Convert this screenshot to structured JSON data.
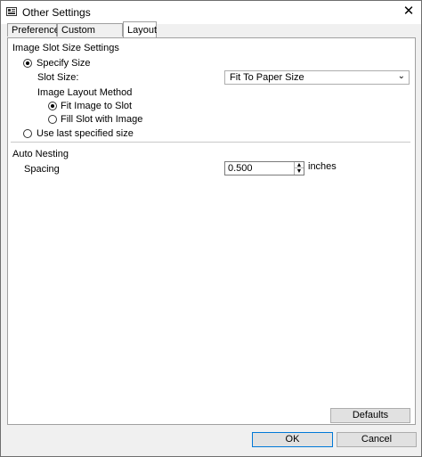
{
  "window": {
    "title": "Other Settings"
  },
  "tabs": [
    {
      "label": "Preferences"
    },
    {
      "label": "Custom Settings"
    },
    {
      "label": "Layout"
    }
  ],
  "image_slot": {
    "section_title": "Image Slot Size Settings",
    "specify_size_label": "Specify Size",
    "slot_size_label": "Slot Size:",
    "slot_size_value": "Fit To Paper Size",
    "layout_method_label": "Image Layout Method",
    "fit_to_slot_label": "Fit Image to Slot",
    "fill_slot_label": "Fill Slot with Image",
    "use_last_label": "Use last specified size"
  },
  "auto_nesting": {
    "section_title": "Auto Nesting",
    "spacing_label": "Spacing",
    "spacing_value": "0.500",
    "spacing_unit": "inches"
  },
  "buttons": {
    "defaults": "Defaults",
    "ok": "OK",
    "cancel": "Cancel"
  }
}
